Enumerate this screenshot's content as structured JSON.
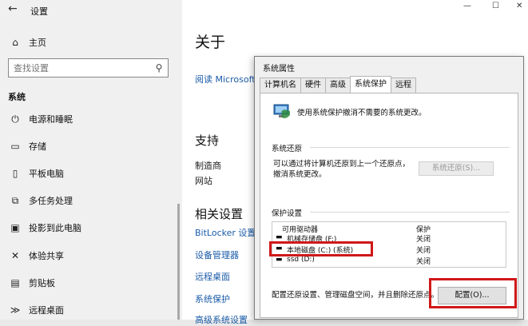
{
  "settings": {
    "window_title": "设置",
    "home_label": "主页",
    "search_placeholder": "查找设置",
    "section": "系统",
    "nav_items": [
      {
        "label": "电源和睡眠",
        "icon": "power-icon"
      },
      {
        "label": "存储",
        "icon": "storage-icon"
      },
      {
        "label": "平板电脑",
        "icon": "tablet-icon"
      },
      {
        "label": "多任务处理",
        "icon": "multitask-icon"
      },
      {
        "label": "投影到此电脑",
        "icon": "project-icon"
      },
      {
        "label": "体验共享",
        "icon": "share-icon"
      },
      {
        "label": "剪贴板",
        "icon": "clipboard-icon"
      },
      {
        "label": "远程桌面",
        "icon": "remote-desktop-icon"
      }
    ]
  },
  "about": {
    "title": "关于",
    "top_link": "阅读 Microsoft 软",
    "support_heading": "支持",
    "manufacturer_label": "制造商",
    "website_label": "网站",
    "related_heading": "相关设置",
    "related_links": [
      "BitLocker 设置",
      "设备管理器",
      "远程桌面",
      "系统保护",
      "高级系统设置"
    ]
  },
  "dialog": {
    "title": "系统属性",
    "tabs": [
      "计算机名",
      "硬件",
      "高级",
      "系统保护",
      "远程"
    ],
    "active_tab": "系统保护",
    "intro": "使用系统保护撤消不需要的系统更改。",
    "restore_group": "系统还原",
    "restore_text": "可以通过将计算机还原到上一个还原点，撤消系统更改。",
    "restore_button": "系统还原(S)...",
    "protection_group": "保护设置",
    "columns": [
      "可用驱动器",
      "保护"
    ],
    "drives": [
      {
        "name": "机械存储盘 (F:)",
        "status": "关闭"
      },
      {
        "name": "本地磁盘 (C:) (系统)",
        "status": "关闭"
      },
      {
        "name": "ssd (D:)",
        "status": "关闭"
      }
    ],
    "config_text": "配置还原设置、管理磁盘空间，并且删除还原点。",
    "config_button": "配置(O)..."
  },
  "colors": {
    "link": "#1a5ba8",
    "highlight": "#d01818"
  }
}
